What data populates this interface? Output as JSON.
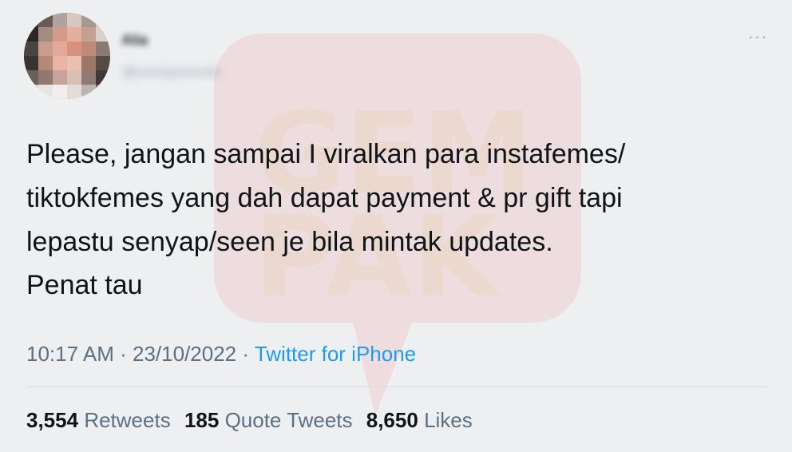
{
  "user": {
    "display_name": "Alia",
    "handle": "@xxxxiyxxxxxlx"
  },
  "tweet": {
    "text": "Please, jangan sampai I viralkan para instafemes/\ntiktokfemes yang dah dapat payment & pr gift tapi\nlepastu senyap/seen je bila mintak updates.",
    "text2": "Penat tau",
    "time": "10:17 AM",
    "date": "23/10/2022",
    "separator": "·",
    "source": "Twitter for iPhone"
  },
  "stats": {
    "retweets_count": "3,554",
    "retweets_label": "Retweets",
    "quotes_count": "185",
    "quotes_label": "Quote Tweets",
    "likes_count": "8,650",
    "likes_label": "Likes"
  },
  "icons": {
    "more": "more-horizontal-icon"
  },
  "watermark": {
    "text_line1": "GEM",
    "text_line2": "PAK",
    "color": "#f2626b"
  },
  "colors": {
    "background": "#eeeff1",
    "text": "#0f1419",
    "secondary": "#5b7083",
    "link": "#1d9bf0"
  }
}
